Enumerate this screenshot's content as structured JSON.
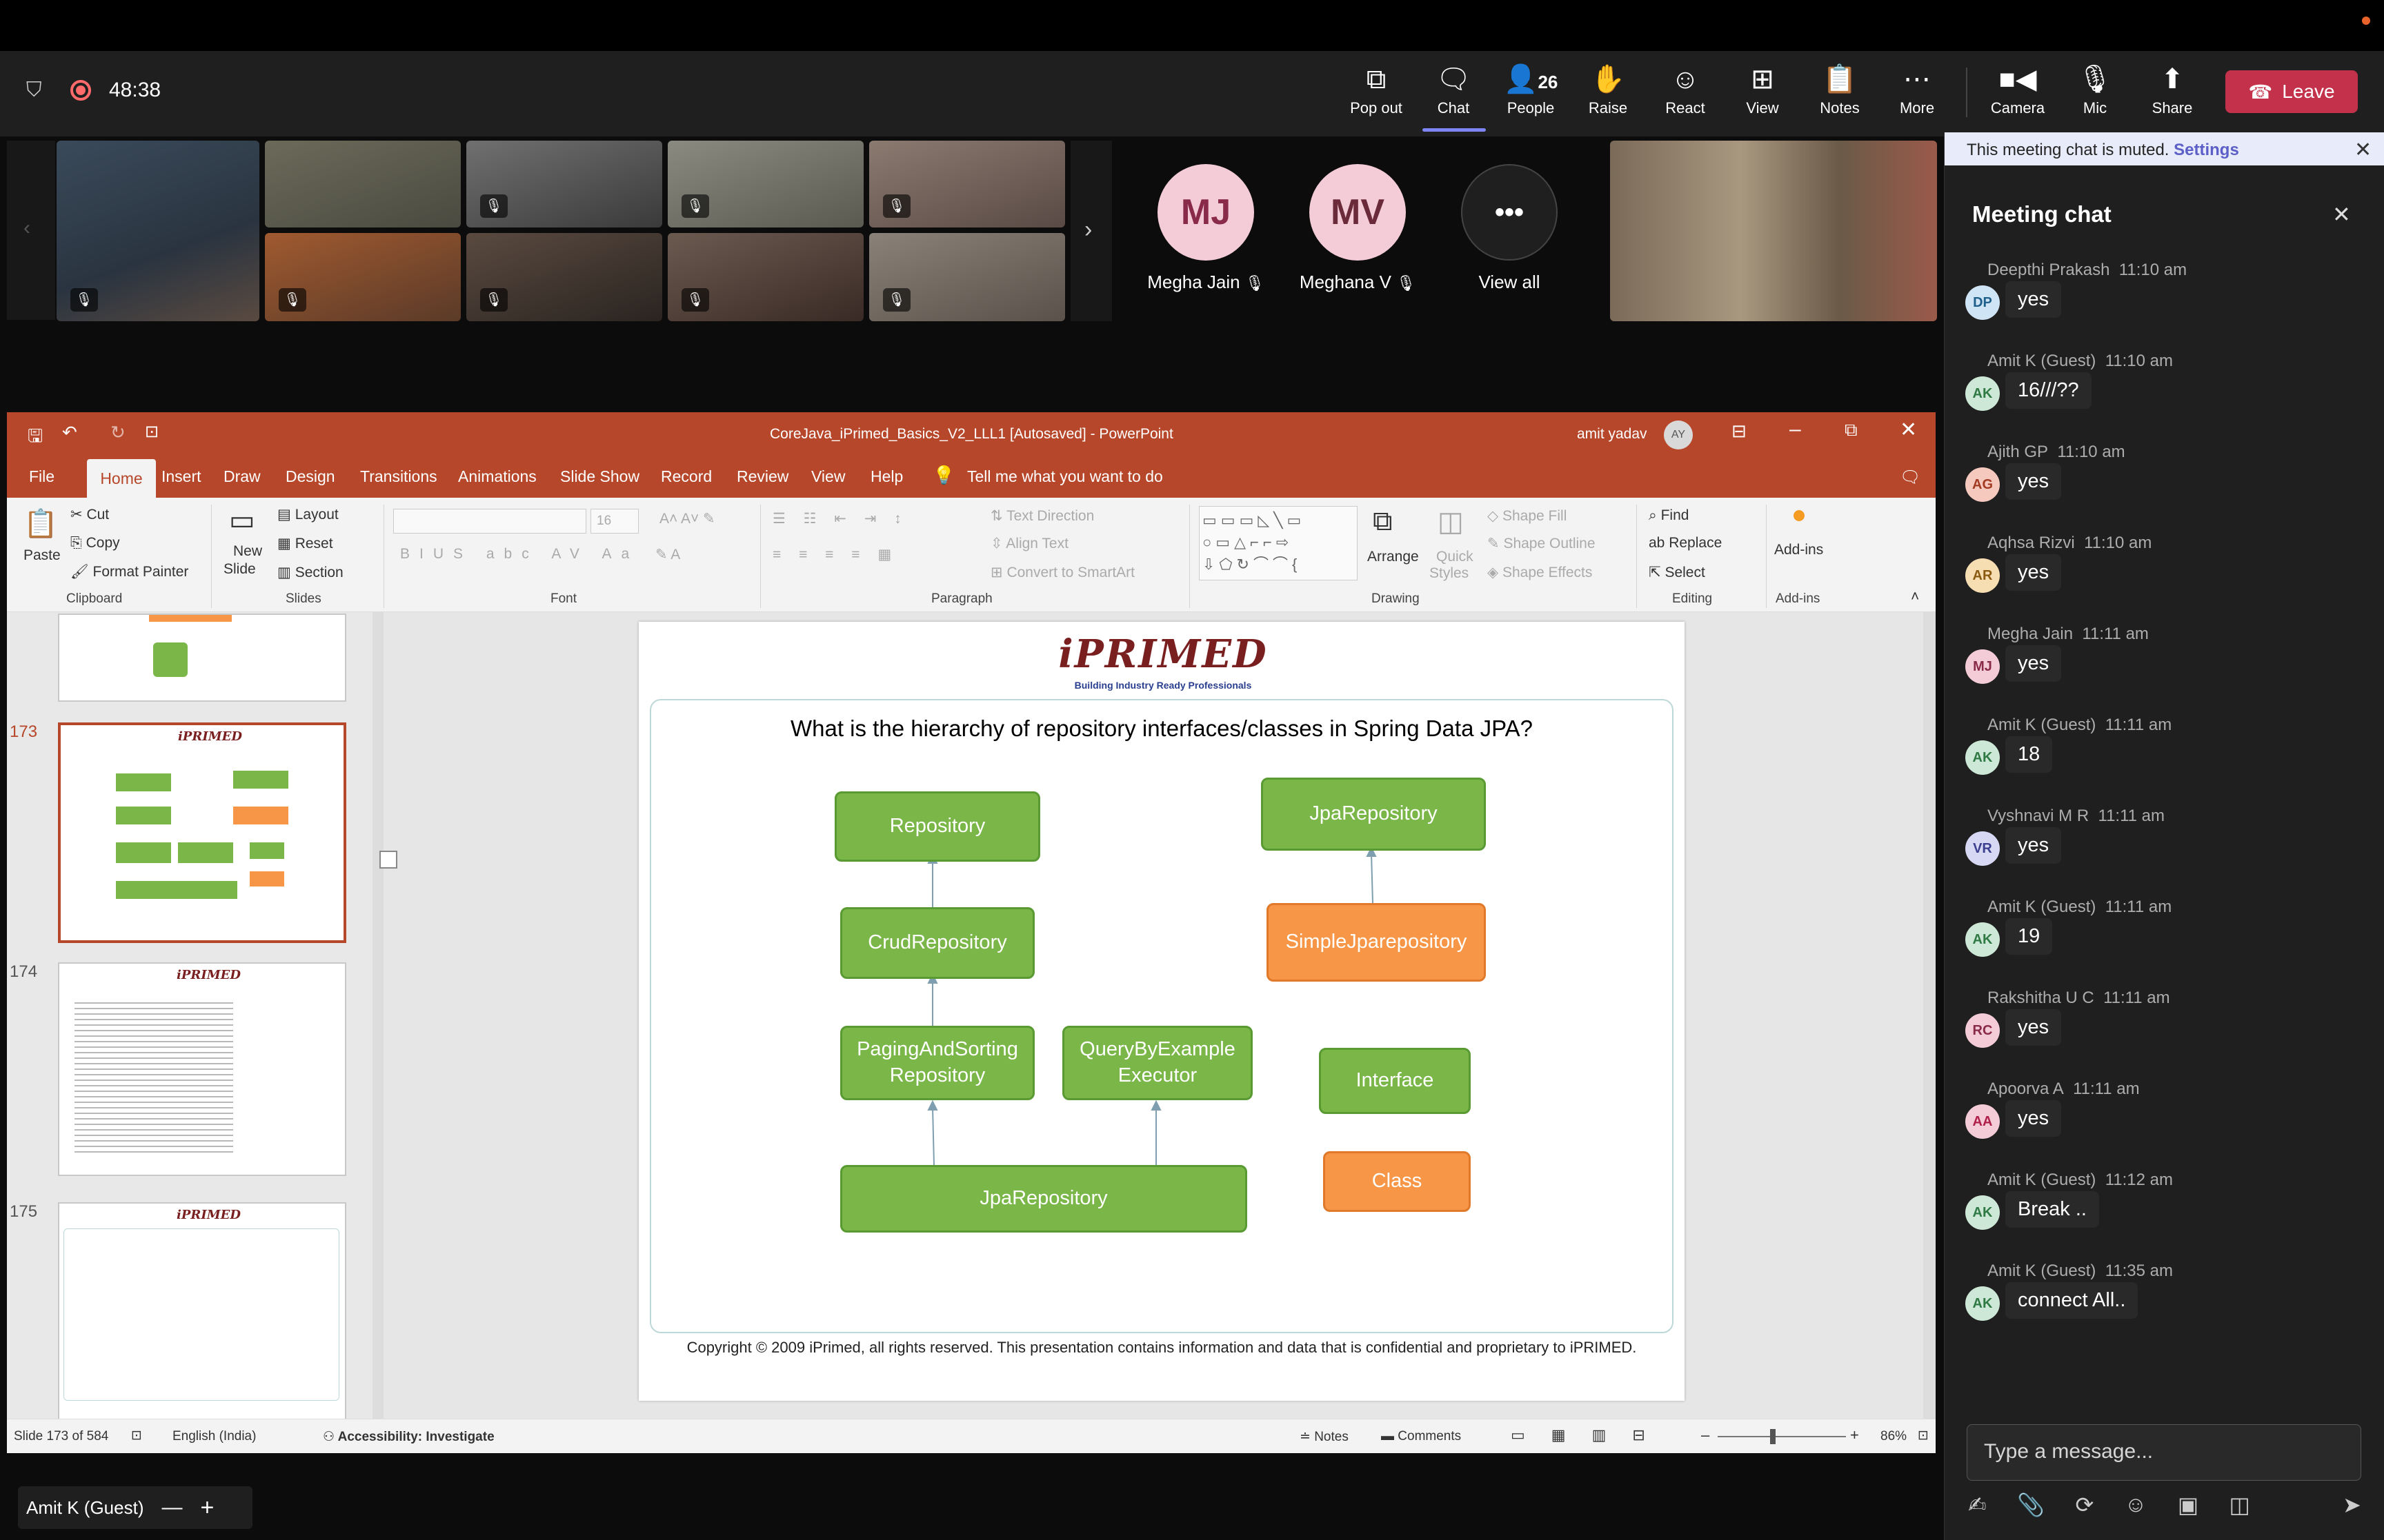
{
  "meeting": {
    "timer": "48:38",
    "toolbar": [
      {
        "label": "Pop out",
        "icon": "pop-out-icon"
      },
      {
        "label": "Chat",
        "icon": "chat-icon"
      },
      {
        "label": "People",
        "icon": "people-icon"
      },
      {
        "label": "Raise",
        "icon": "raise-hand-icon"
      },
      {
        "label": "React",
        "icon": "react-icon"
      },
      {
        "label": "View",
        "icon": "view-icon"
      },
      {
        "label": "Notes",
        "icon": "notes-icon"
      },
      {
        "label": "More",
        "icon": "more-icon"
      }
    ],
    "people_count": "26",
    "controls": [
      {
        "label": "Camera",
        "icon": "camera-icon"
      },
      {
        "label": "Mic",
        "icon": "mic-off-icon"
      },
      {
        "label": "Share",
        "icon": "share-icon"
      }
    ],
    "leave_label": "Leave",
    "participants_named": [
      {
        "initials": "MJ",
        "name": "Megha Jain"
      },
      {
        "initials": "MV",
        "name": "Meghana V"
      }
    ],
    "view_all_label": "View all",
    "self_name": "Amit K (Guest)"
  },
  "ppt": {
    "title": "CoreJava_iPrimed_Basics_V2_LLL1 [Autosaved]  -  PowerPoint",
    "user": "amit yadav",
    "user_initials": "AY",
    "menu": [
      "File",
      "Home",
      "Insert",
      "Draw",
      "Design",
      "Transitions",
      "Animations",
      "Slide Show",
      "Record",
      "Review",
      "View",
      "Help"
    ],
    "tell_me": "Tell me what you want to do",
    "ribbon": {
      "paste": "Paste",
      "cut": "Cut",
      "copy": "Copy",
      "format_painter": "Format Painter",
      "clipboard": "Clipboard",
      "new_slide": "New",
      "new_slide2": "Slide",
      "layout": "Layout",
      "reset": "Reset",
      "section": "Section",
      "slides": "Slides",
      "font_size": "16",
      "font": "Font",
      "text_direction": "Text Direction",
      "align_text": "Align Text",
      "convert_smartart": "Convert to SmartArt",
      "paragraph": "Paragraph",
      "arrange": "Arrange",
      "quick_styles": "Quick",
      "quick_styles2": "Styles",
      "shape_fill": "Shape Fill",
      "shape_outline": "Shape Outline",
      "shape_effects": "Shape Effects",
      "drawing": "Drawing",
      "find": "Find",
      "replace": "Replace",
      "select": "Select",
      "editing": "Editing",
      "addins": "Add-ins",
      "addins_group": "Add-ins"
    },
    "thumbs": [
      "173",
      "174",
      "175"
    ],
    "slide": {
      "logo": "iPRIMED",
      "logo_sub": "Building Industry Ready Professionals",
      "question": "What is the hierarchy of repository interfaces/classes in Spring Data JPA?",
      "boxes": {
        "repository": "Repository",
        "crud": "CrudRepository",
        "paging1": "PagingAndSorting",
        "paging2": "Repository",
        "qbe1": "QueryByExample",
        "qbe2": "Executor",
        "jpa_bottom": "JpaRepository",
        "jpa_top": "JpaRepository",
        "simple": "SimpleJparepository",
        "legend_interface": "Interface",
        "legend_class": "Class"
      },
      "copyright": "Copyright © 2009 iPrimed, all rights reserved. This presentation contains information  and data  that is confidential and proprietary to iPRIMED."
    },
    "status": {
      "slide": "Slide 173 of 584",
      "language": "English (India)",
      "accessibility": "Accessibility: Investigate",
      "notes": "Notes",
      "comments": "Comments",
      "zoom": "86%"
    }
  },
  "chat": {
    "muted_text": "This meeting chat is muted.",
    "settings": "Settings",
    "title": "Meeting chat",
    "messages": [
      {
        "name": "Deepthi Prakash",
        "time": "11:10 am",
        "initials": "DP",
        "text": "yes",
        "color": "#cfe4f5",
        "fg": "#1f5f8b"
      },
      {
        "name": "Amit K (Guest)",
        "time": "11:10 am",
        "initials": "AK",
        "text": "16///??",
        "color": "#cde8d6",
        "fg": "#2f7a45"
      },
      {
        "name": "Ajith GP",
        "time": "11:10 am",
        "initials": "AG",
        "text": "yes",
        "color": "#f6c9bf",
        "fg": "#a33a22"
      },
      {
        "name": "Aqhsa Rizvi",
        "time": "11:10 am",
        "initials": "AR",
        "text": "yes",
        "color": "#f7ddb2",
        "fg": "#8a5a12"
      },
      {
        "name": "Megha Jain",
        "time": "11:11 am",
        "initials": "MJ",
        "text": "yes",
        "color": "#f4ccd8",
        "fg": "#8a2a4a"
      },
      {
        "name": "Amit K (Guest)",
        "time": "11:11 am",
        "initials": "AK",
        "text": "18",
        "color": "#cde8d6",
        "fg": "#2f7a45"
      },
      {
        "name": "Vyshnavi M R",
        "time": "11:11 am",
        "initials": "VR",
        "text": "yes",
        "color": "#d7d9f4",
        "fg": "#3c3f8f"
      },
      {
        "name": "Amit K (Guest)",
        "time": "11:11 am",
        "initials": "AK",
        "text": "19",
        "color": "#cde8d6",
        "fg": "#2f7a45"
      },
      {
        "name": "Rakshitha U C",
        "time": "11:11 am",
        "initials": "RC",
        "text": "yes",
        "color": "#f4ccd8",
        "fg": "#8a2a4a"
      },
      {
        "name": "Apoorva A",
        "time": "11:11 am",
        "initials": "AA",
        "text": "yes",
        "color": "#f4ccd8",
        "fg": "#b0204a"
      },
      {
        "name": "Amit K (Guest)",
        "time": "11:12 am",
        "initials": "AK",
        "text": "Break ..",
        "color": "#cde8d6",
        "fg": "#2f7a45"
      },
      {
        "name": "Amit K (Guest)",
        "time": "11:35 am",
        "initials": "AK",
        "text": "connect All..",
        "color": "#cde8d6",
        "fg": "#2f7a45"
      }
    ],
    "placeholder": "Type a message..."
  }
}
